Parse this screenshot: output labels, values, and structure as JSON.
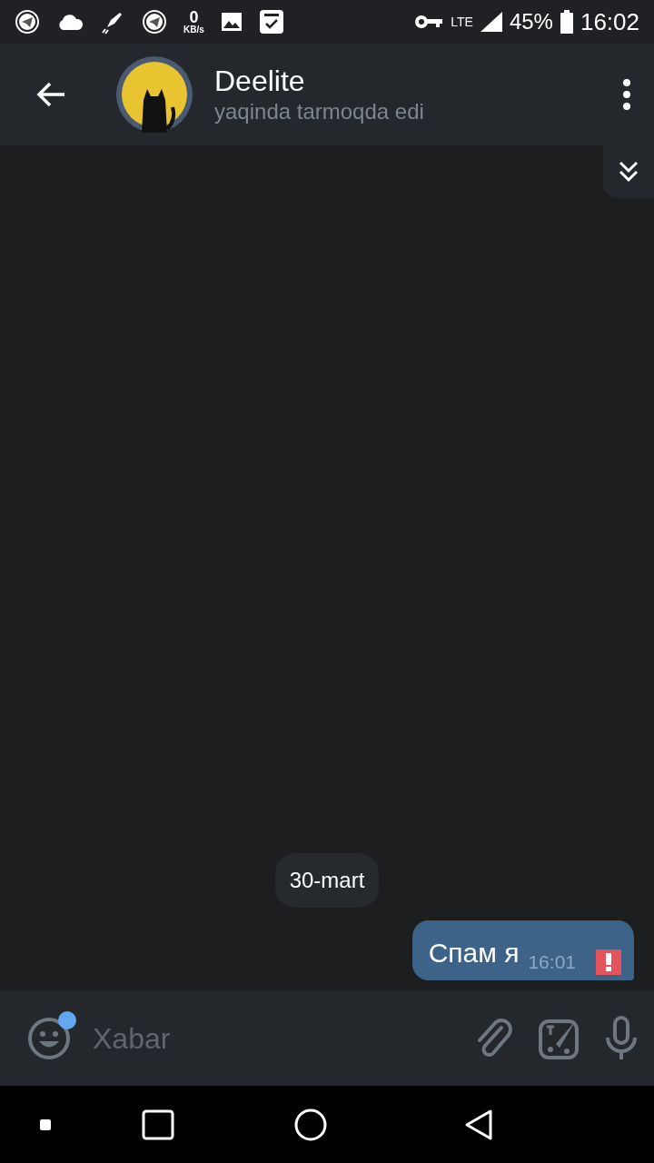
{
  "status_bar": {
    "speed_value": "0",
    "speed_unit": "KB/s",
    "network": "LTE",
    "battery": "45%",
    "time": "16:02"
  },
  "header": {
    "name": "Deelite",
    "status": "yaqinda tarmoqda edi"
  },
  "date_chip": "30-mart",
  "messages": [
    {
      "text": "Спам я",
      "time": "16:01",
      "failed": true
    }
  ],
  "composer": {
    "placeholder": "Xabar",
    "emoji_badge": true
  }
}
